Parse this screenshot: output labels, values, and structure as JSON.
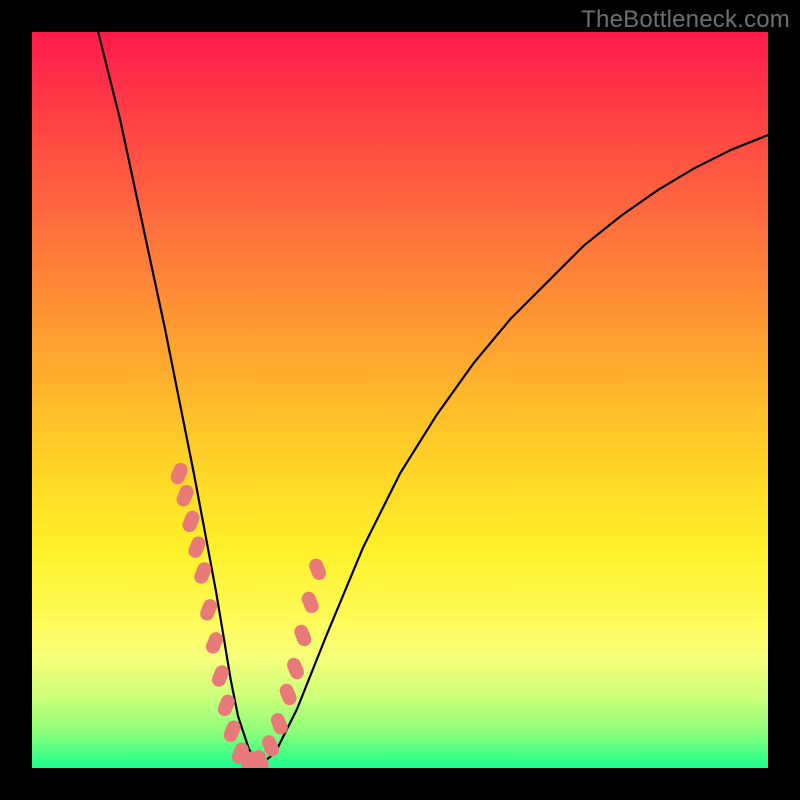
{
  "watermark": "TheBottleneck.com",
  "chart_data": {
    "type": "line",
    "title": "",
    "xlabel": "",
    "ylabel": "",
    "xlim": [
      0,
      100
    ],
    "ylim": [
      0,
      100
    ],
    "note": "V-shaped bottleneck curve over a red→green vertical gradient. Axes are implicit (no ticks/labels in source). Values below are approximate pixel-read positions normalized to 0–100 on each axis; y is visual height from bottom (green=0, red=100).",
    "series": [
      {
        "name": "bottleneck-curve",
        "x": [
          9,
          12,
          15,
          18,
          20,
          22,
          23.5,
          25,
          26,
          27,
          28,
          29.5,
          31,
          33,
          36,
          40,
          45,
          50,
          55,
          60,
          65,
          70,
          75,
          80,
          85,
          90,
          95,
          100
        ],
        "y": [
          100,
          88,
          74,
          60,
          50,
          40,
          32,
          24,
          18,
          12,
          7,
          2.5,
          0.5,
          2,
          8,
          18,
          30,
          40,
          48,
          55,
          61,
          66,
          71,
          75,
          78.5,
          81.5,
          84,
          86
        ]
      }
    ],
    "markers": {
      "color": "#e97a7a",
      "shape": "rounded-capsule",
      "points_xy": [
        [
          20.0,
          40.0
        ],
        [
          20.8,
          37.0
        ],
        [
          21.6,
          33.5
        ],
        [
          22.4,
          30.0
        ],
        [
          23.2,
          26.5
        ],
        [
          24.0,
          21.5
        ],
        [
          24.8,
          17.0
        ],
        [
          25.6,
          12.5
        ],
        [
          26.4,
          8.5
        ],
        [
          27.2,
          5.0
        ],
        [
          28.3,
          2.0
        ],
        [
          29.6,
          0.8
        ],
        [
          31.0,
          1.0
        ],
        [
          32.4,
          3.0
        ],
        [
          33.6,
          6.0
        ],
        [
          34.8,
          10.0
        ],
        [
          35.8,
          13.5
        ],
        [
          36.8,
          18.0
        ],
        [
          37.8,
          22.5
        ],
        [
          38.8,
          27.0
        ]
      ]
    },
    "gradient_stops": [
      {
        "pos": 0.0,
        "color": "#ff1a4d"
      },
      {
        "pos": 0.25,
        "color": "#ff6b3e"
      },
      {
        "pos": 0.55,
        "color": "#ffc928"
      },
      {
        "pos": 0.8,
        "color": "#fffb5a"
      },
      {
        "pos": 0.95,
        "color": "#8fff7a"
      },
      {
        "pos": 1.0,
        "color": "#1aff8a"
      }
    ]
  }
}
